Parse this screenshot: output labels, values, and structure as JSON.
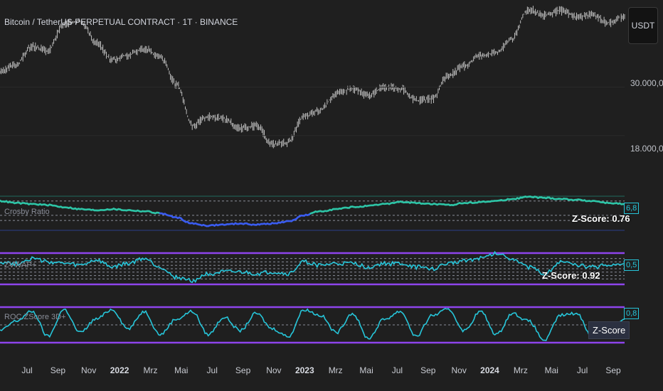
{
  "chart_title": "Bitcoin / TetherUS PERPETUAL CONTRACT · 1T · BINANCE",
  "currency_button": "USDT",
  "price_labels": [
    "30.000,0",
    "18.000,0"
  ],
  "colors": {
    "background": "#1f1f1f",
    "price": "#cfcfcf",
    "accent_cyan": "#26c6da",
    "accent_blue": "#3a5cf0",
    "band_purple": "#8e44ec",
    "teal": "#2ec4a6"
  },
  "chart_data": [
    {
      "type": "line",
      "panel": "price",
      "yscale": "log",
      "ylim": [
        12000,
        75000
      ],
      "x": [
        "2021-06",
        "2021-07",
        "2021-08",
        "2021-09",
        "2021-10",
        "2021-11",
        "2021-12",
        "2022-01",
        "2022-02",
        "2022-03",
        "2022-04",
        "2022-05",
        "2022-06",
        "2022-07",
        "2022-08",
        "2022-09",
        "2022-10",
        "2022-11",
        "2022-12",
        "2023-01",
        "2023-02",
        "2023-03",
        "2023-04",
        "2023-05",
        "2023-06",
        "2023-07",
        "2023-08",
        "2023-09",
        "2023-10",
        "2023-11",
        "2023-12",
        "2024-01",
        "2024-02",
        "2024-03",
        "2024-04",
        "2024-05",
        "2024-06",
        "2024-07",
        "2024-08",
        "2024-09"
      ],
      "values": [
        35000,
        38000,
        46000,
        44000,
        58000,
        60000,
        48000,
        40000,
        42000,
        45000,
        41000,
        31000,
        20000,
        22000,
        21500,
        19500,
        20000,
        16500,
        16800,
        22000,
        23500,
        28000,
        29500,
        27500,
        30000,
        29500,
        26000,
        26500,
        34000,
        37500,
        42000,
        43000,
        50000,
        68000,
        64000,
        67000,
        63000,
        64000,
        59000,
        63000
      ],
      "price_labels": [
        "30.000,0",
        "18.000,0"
      ]
    },
    {
      "type": "line",
      "panel": "oscillator-1",
      "label": "Crosby Ratio",
      "value_badge": "6,8",
      "zscore_label": "Z-Score: 0.76",
      "values": [
        0.6,
        0.5,
        0.45,
        0.4,
        0.3,
        0.2,
        0.15,
        0.2,
        0.15,
        0.1,
        0.0,
        -0.2,
        -0.5,
        -0.6,
        -0.55,
        -0.5,
        -0.55,
        -0.5,
        -0.4,
        -0.1,
        0.1,
        0.2,
        0.3,
        0.35,
        0.45,
        0.55,
        0.5,
        0.45,
        0.4,
        0.5,
        0.55,
        0.6,
        0.7,
        0.8,
        0.75,
        0.7,
        0.65,
        0.6,
        0.5,
        0.45
      ],
      "ylim": [
        -0.9,
        0.9
      ]
    },
    {
      "type": "line",
      "panel": "oscillator-2",
      "label": "ZVWAP+",
      "value_badge": "0,5",
      "zscore_label": "Z-Score: 0.92",
      "values": [
        0.4,
        0.3,
        0.6,
        0.4,
        0.3,
        0.2,
        0.5,
        0.1,
        0.3,
        0.6,
        0.1,
        -0.5,
        -0.7,
        -0.3,
        -0.2,
        -0.2,
        -0.3,
        -0.2,
        -0.3,
        0.4,
        0.2,
        0.3,
        0.3,
        0.1,
        0.3,
        0.3,
        0.1,
        0.0,
        0.3,
        0.5,
        0.6,
        0.9,
        0.6,
        0.1,
        -0.3,
        0.4,
        0.2,
        0.1,
        0.2,
        0.3
      ],
      "ylim": [
        -1,
        1
      ]
    },
    {
      "type": "line",
      "panel": "oscillator-3",
      "label": "ROC ZScore 3D+",
      "value_badge": "0,8",
      "zscore_label": "Z-Score",
      "values": [
        -0.3,
        0.2,
        0.7,
        -0.6,
        0.8,
        -0.4,
        0.3,
        0.8,
        -0.2,
        0.7,
        -0.5,
        0.3,
        0.7,
        -0.5,
        0.4,
        -0.3,
        0.6,
        -0.2,
        -0.6,
        0.8,
        0.5,
        -0.4,
        0.6,
        -0.7,
        0.3,
        0.7,
        -0.6,
        0.5,
        0.8,
        -0.3,
        0.7,
        -0.5,
        0.6,
        0.2,
        -0.8,
        0.5,
        0.6,
        -0.6,
        -0.5,
        0.3
      ],
      "ylim": [
        -1,
        1
      ]
    }
  ],
  "x_axis": [
    {
      "label": "Jul",
      "bold": false
    },
    {
      "label": "Sep",
      "bold": false
    },
    {
      "label": "Nov",
      "bold": false
    },
    {
      "label": "2022",
      "bold": true
    },
    {
      "label": "Mrz",
      "bold": false
    },
    {
      "label": "Mai",
      "bold": false
    },
    {
      "label": "Jul",
      "bold": false
    },
    {
      "label": "Sep",
      "bold": false
    },
    {
      "label": "Nov",
      "bold": false
    },
    {
      "label": "2023",
      "bold": true
    },
    {
      "label": "Mrz",
      "bold": false
    },
    {
      "label": "Mai",
      "bold": false
    },
    {
      "label": "Jul",
      "bold": false
    },
    {
      "label": "Sep",
      "bold": false
    },
    {
      "label": "Nov",
      "bold": false
    },
    {
      "label": "2024",
      "bold": true
    },
    {
      "label": "Mrz",
      "bold": false
    },
    {
      "label": "Mai",
      "bold": false
    },
    {
      "label": "Jul",
      "bold": false
    },
    {
      "label": "Sep",
      "bold": false
    }
  ]
}
